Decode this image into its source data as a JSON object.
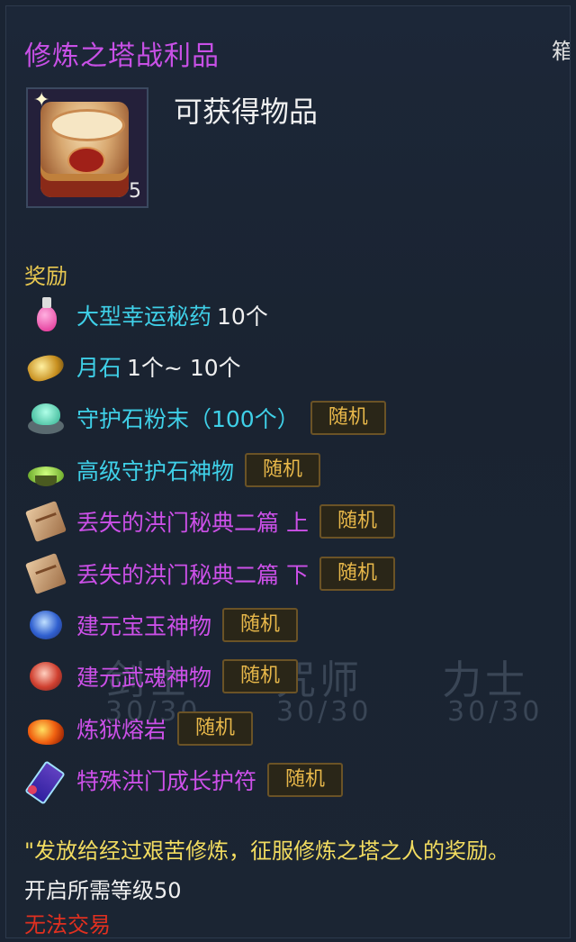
{
  "tooltip": {
    "title": "修炼之塔战利品",
    "corner_text": "箱",
    "item_quantity": "5",
    "obtain_label": "可获得物品",
    "section_label": "奖励",
    "random_badge": "随机",
    "rewards": [
      {
        "name": "大型幸运秘药",
        "count": "10个",
        "badge": "",
        "color": "#3fd0e8",
        "icon": "pink-potion-icon"
      },
      {
        "name": "月石",
        "count": "1个~ 10个",
        "badge": "",
        "color": "#3fd0e8",
        "icon": "gold-ore-icon"
      },
      {
        "name": "守护石粉末（100个）",
        "count": "",
        "badge": "随机",
        "color": "#3fd0e8",
        "icon": "green-powder-icon"
      },
      {
        "name": "高级守护石神物",
        "count": "",
        "badge": "随机",
        "color": "#3fd0e8",
        "icon": "green-bowl-icon"
      },
      {
        "name": "丢失的洪门秘典二篇 上",
        "count": "",
        "badge": "随机",
        "color": "#cc50e8",
        "icon": "scroll-icon"
      },
      {
        "name": "丢失的洪门秘典二篇 下",
        "count": "",
        "badge": "随机",
        "color": "#cc50e8",
        "icon": "scroll-icon"
      },
      {
        "name": "建元宝玉神物",
        "count": "",
        "badge": "随机",
        "color": "#cc50e8",
        "icon": "blue-flower-icon"
      },
      {
        "name": "建元武魂神物",
        "count": "",
        "badge": "随机",
        "color": "#cc50e8",
        "icon": "red-flower-icon"
      },
      {
        "name": "炼狱熔岩",
        "count": "",
        "badge": "随机",
        "color": "#cc50e8",
        "icon": "lava-icon"
      },
      {
        "name": "特殊洪门成长护符",
        "count": "",
        "badge": "随机",
        "color": "#cc50e8",
        "icon": "talisman-icon"
      }
    ],
    "description": "\"发放给经过艰苦修炼，征服修炼之塔之人的奖励。",
    "level_requirement": "开启所需等级50",
    "trade_status": "无法交易"
  },
  "background": {
    "ghost_labels": [
      "剑士",
      "咒师",
      "力士"
    ],
    "ghost_counts": [
      "30/30",
      "30/30",
      "30/30"
    ]
  }
}
